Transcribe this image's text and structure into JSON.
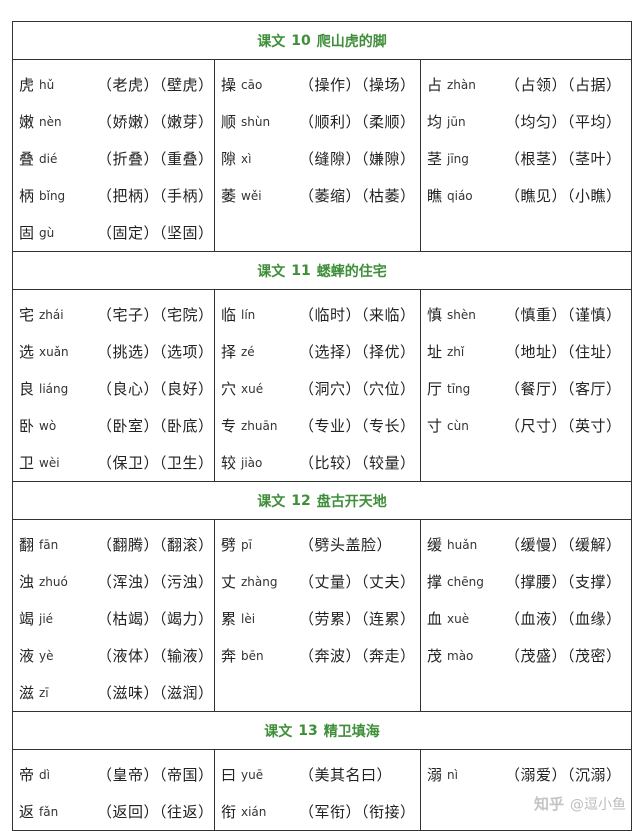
{
  "lessons": [
    {
      "label": "课文",
      "number": "10",
      "name": "爬山虎的脚",
      "columns": [
        [
          {
            "char": "虎",
            "pinyin": "hǔ",
            "words": "（老虎）（壁虎）"
          },
          {
            "char": "嫩",
            "pinyin": "nèn",
            "words": "（娇嫩）（嫩芽）"
          },
          {
            "char": "叠",
            "pinyin": "dié",
            "words": "（折叠）（重叠）"
          },
          {
            "char": "柄",
            "pinyin": "bǐng",
            "words": "（把柄）（手柄）"
          },
          {
            "char": "固",
            "pinyin": "gù",
            "words": "（固定）（坚固）"
          }
        ],
        [
          {
            "char": "操",
            "pinyin": "cāo",
            "words": "（操作）（操场）"
          },
          {
            "char": "顺",
            "pinyin": "shùn",
            "words": "（顺利）（柔顺）"
          },
          {
            "char": "隙",
            "pinyin": "xì",
            "words": "（缝隙）（嫌隙）"
          },
          {
            "char": "萎",
            "pinyin": "wěi",
            "words": "（萎缩）（枯萎）"
          }
        ],
        [
          {
            "char": "占",
            "pinyin": "zhàn",
            "words": "（占领）（占据）"
          },
          {
            "char": "均",
            "pinyin": "jūn",
            "words": "（均匀）（平均）"
          },
          {
            "char": "茎",
            "pinyin": "jīng",
            "words": "（根茎）（茎叶）"
          },
          {
            "char": "瞧",
            "pinyin": "qiáo",
            "words": "（瞧见）（小瞧）"
          }
        ]
      ]
    },
    {
      "label": "课文",
      "number": "11",
      "name": "蟋蟀的住宅",
      "columns": [
        [
          {
            "char": "宅",
            "pinyin": "zhái",
            "words": "（宅子）（宅院）"
          },
          {
            "char": "选",
            "pinyin": "xuǎn",
            "words": "（挑选）（选项）"
          },
          {
            "char": "良",
            "pinyin": "liáng",
            "words": "（良心）（良好）"
          },
          {
            "char": "卧",
            "pinyin": "wò",
            "words": "（卧室）（卧底）"
          },
          {
            "char": "卫",
            "pinyin": "wèi",
            "words": "（保卫）（卫生）"
          }
        ],
        [
          {
            "char": "临",
            "pinyin": "lín",
            "words": "（临时）（来临）"
          },
          {
            "char": "择",
            "pinyin": "zé",
            "words": "（选择）（择优）"
          },
          {
            "char": "穴",
            "pinyin": "xué",
            "words": "（洞穴）（穴位）"
          },
          {
            "char": "专",
            "pinyin": "zhuān",
            "words": "（专业）（专长）"
          },
          {
            "char": "较",
            "pinyin": "jiào",
            "words": "（比较）（较量）"
          }
        ],
        [
          {
            "char": "慎",
            "pinyin": "shèn",
            "words": "（慎重）（谨慎）"
          },
          {
            "char": "址",
            "pinyin": "zhǐ",
            "words": "（地址）（住址）"
          },
          {
            "char": "厅",
            "pinyin": "tīng",
            "words": "（餐厅）（客厅）"
          },
          {
            "char": "寸",
            "pinyin": "cùn",
            "words": "（尺寸）（英寸）"
          }
        ]
      ]
    },
    {
      "label": "课文",
      "number": "12",
      "name": "盘古开天地",
      "columns": [
        [
          {
            "char": "翻",
            "pinyin": "fān",
            "words": "（翻腾）（翻滚）"
          },
          {
            "char": "浊",
            "pinyin": "zhuó",
            "words": "（浑浊）（污浊）"
          },
          {
            "char": "竭",
            "pinyin": "jié",
            "words": "（枯竭）（竭力）"
          },
          {
            "char": "液",
            "pinyin": "yè",
            "words": "（液体）（输液）"
          },
          {
            "char": "滋",
            "pinyin": "zī",
            "words": "（滋味）（滋润）"
          }
        ],
        [
          {
            "char": "劈",
            "pinyin": "pī",
            "words": "（劈头盖脸）"
          },
          {
            "char": "丈",
            "pinyin": "zhàng",
            "words": "（丈量）（丈夫）"
          },
          {
            "char": "累",
            "pinyin": "lèi",
            "words": "（劳累）（连累）"
          },
          {
            "char": "奔",
            "pinyin": "bēn",
            "words": "（奔波）（奔走）"
          }
        ],
        [
          {
            "char": "缓",
            "pinyin": "huǎn",
            "words": "（缓慢）（缓解）"
          },
          {
            "char": "撑",
            "pinyin": "chēng",
            "words": "（撑腰）（支撑）"
          },
          {
            "char": "血",
            "pinyin": "xuè",
            "words": "（血液）（血缘）"
          },
          {
            "char": "茂",
            "pinyin": "mào",
            "words": "（茂盛）（茂密）"
          }
        ]
      ]
    },
    {
      "label": "课文",
      "number": "13",
      "name": "精卫填海",
      "columns": [
        [
          {
            "char": "帝",
            "pinyin": "dì",
            "words": "（皇帝）（帝国）"
          },
          {
            "char": "返",
            "pinyin": "fǎn",
            "words": "（返回）（往返）"
          }
        ],
        [
          {
            "char": "曰",
            "pinyin": "yuē",
            "words": "（美其名曰）"
          },
          {
            "char": "衔",
            "pinyin": "xián",
            "words": "（军衔）（衔接）"
          }
        ],
        [
          {
            "char": "溺",
            "pinyin": "nì",
            "words": "（溺爱）（沉溺）"
          }
        ]
      ]
    }
  ],
  "watermark": {
    "logo": "知乎",
    "author": "@逗小鱼"
  }
}
